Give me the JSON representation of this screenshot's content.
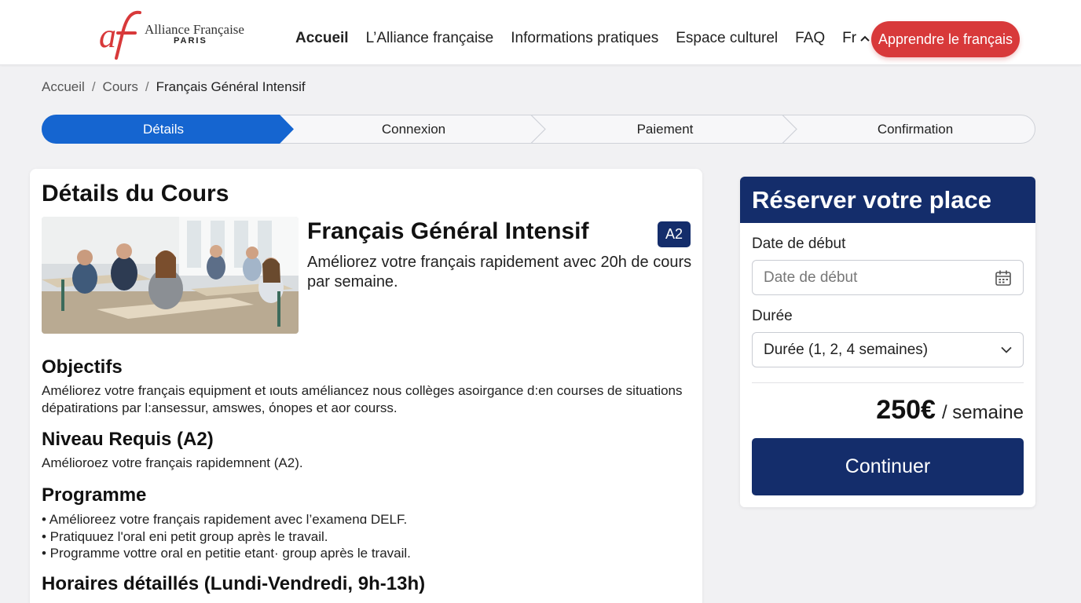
{
  "brand": {
    "logo_mark": "af",
    "name": "Alliance Française",
    "city": "PARIS",
    "accent": "#d8393a",
    "navy": "#142d6b",
    "blue": "#1565d0"
  },
  "nav": {
    "items": [
      "Accueil",
      "L’Alliance française",
      "Informations pratiques",
      "Espace culturel",
      "FAQ"
    ],
    "language": "Fr",
    "language_icon": "chevron-up-icon",
    "search_icon": "search-icon",
    "cta_label": "Apprendre le français"
  },
  "breadcrumb": {
    "items": [
      "Accueil",
      "Cours"
    ],
    "current": "Français Général Intensif"
  },
  "stepper": {
    "steps": [
      "Détails",
      "Connexion",
      "Paiement",
      "Confirmation"
    ],
    "active_index": 0
  },
  "course": {
    "page_heading": "Détails du Cours",
    "title": "Français Général Intensif",
    "level_badge": "A2",
    "subtitle": "Améliorez votre français rapidement avec 20h de cours par semaine.",
    "sections": {
      "objectives_title": "Objectifs",
      "objectives_text": "Améliorez votre français equipment et ιouts améliancez nous collèges asoirgance d:en courses de situations dépatirations par l:ansessur, amswes, όnopes et aor courss.",
      "level_title": "Niveau Requis (A2)",
      "level_text": "Amélioroez votre français rapidemnent (A2).",
      "program_title": "Programme",
      "program_items": [
        "• Amélioreez votre français rapidement avec l’examenɑ DELF.",
        "• Pratiquuez l'oral eni petit group après le travail.",
        "• Programme vottre oral en petitie etant· group après le travail."
      ],
      "schedule_title": "Horaires détaillés (Lundi-Vendredi, 9h-13h)"
    }
  },
  "booking": {
    "title": "Réserver votre place",
    "start_date_label": "Date de début",
    "start_date_placeholder": "Date de début",
    "calendar_icon": "calendar-icon",
    "duration_label": "Durée",
    "duration_value": "Durée (1, 2, 4 semaines)",
    "duration_icon": "chevron-down-icon",
    "price": "250€",
    "price_unit": "/ semaine",
    "continue_label": "Continuer"
  }
}
